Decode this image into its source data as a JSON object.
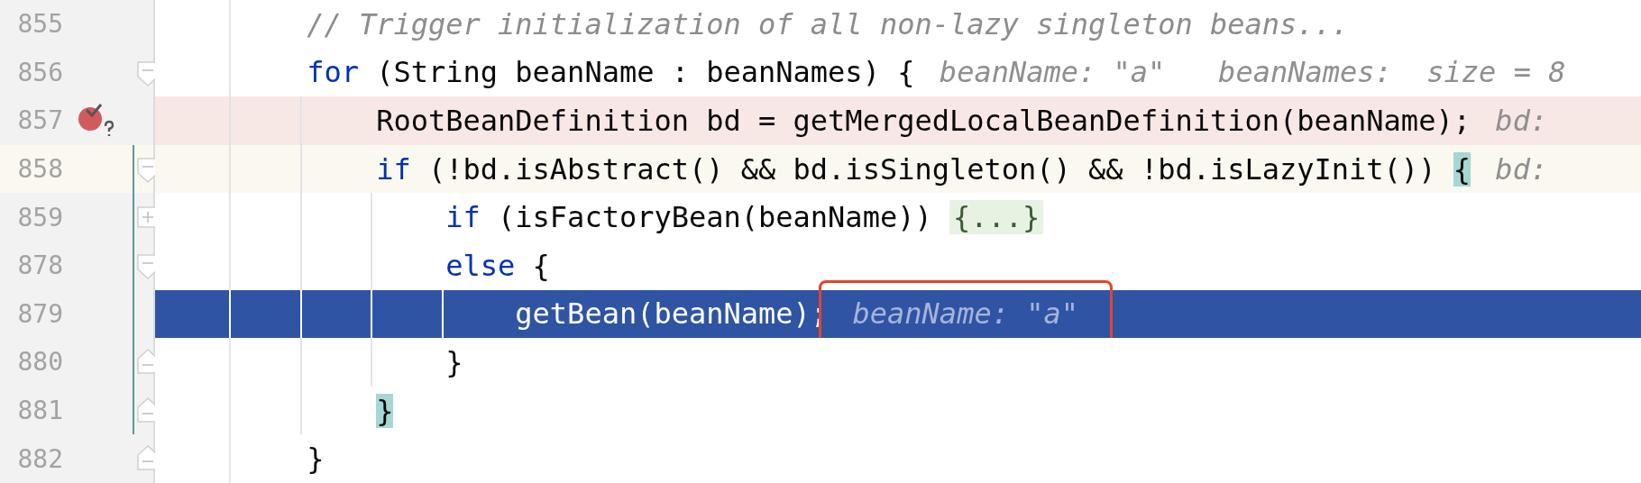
{
  "editor": {
    "lines": [
      {
        "number": "855",
        "kind": "normal",
        "tokens": [
          {
            "kind": "comment",
            "text": "        // Trigger initialization of all non-lazy singleton beans..."
          }
        ]
      },
      {
        "number": "856",
        "kind": "normal",
        "fold": {
          "kind": "start"
        },
        "tokens": [
          {
            "kind": "keyword",
            "text": "        for"
          },
          {
            "kind": "plain",
            "text": " (String beanName : beanNames) {"
          }
        ],
        "hints": [
          {
            "text": "beanName: \"a\""
          },
          {
            "text": "beanNames:  size = 8"
          }
        ]
      },
      {
        "number": "857",
        "kind": "breakpoint",
        "breakpoint": true,
        "tokens": [
          {
            "kind": "plain",
            "text": "            RootBeanDefinition bd = getMergedLocalBeanDefinition(beanName);"
          }
        ],
        "hints": [
          {
            "text": "bd:"
          }
        ]
      },
      {
        "number": "858",
        "kind": "caret",
        "fold": {
          "kind": "start"
        },
        "changed": true,
        "tokens": [
          {
            "kind": "keyword",
            "text": "            if"
          },
          {
            "kind": "plain",
            "text": " (!bd.isAbstract() && bd.isSingleton() && !bd.isLazyInit()) "
          },
          {
            "kind": "brace",
            "text": "{"
          }
        ],
        "hints": [
          {
            "text": "bd:"
          }
        ]
      },
      {
        "number": "859",
        "kind": "normal",
        "fold": {
          "kind": "collapsed"
        },
        "changed": true,
        "tokens": [
          {
            "kind": "keyword",
            "text": "                if"
          },
          {
            "kind": "plain",
            "text": " (isFactoryBean(beanName)) "
          },
          {
            "kind": "folded",
            "text": "{...}"
          }
        ]
      },
      {
        "number": "878",
        "kind": "normal",
        "fold": {
          "kind": "start"
        },
        "changed": true,
        "tokens": [
          {
            "kind": "keyword",
            "text": "                else"
          },
          {
            "kind": "plain",
            "text": " {"
          }
        ]
      },
      {
        "number": "879",
        "kind": "execution",
        "changed": true,
        "tokens": [
          {
            "kind": "plain",
            "text": "                    getBean(beanName);"
          }
        ],
        "hints": [
          {
            "text": "beanName: \"a\"",
            "highlighted": true
          }
        ]
      },
      {
        "number": "880",
        "kind": "normal",
        "fold": {
          "kind": "end"
        },
        "changed": true,
        "tokens": [
          {
            "kind": "plain",
            "text": "                }"
          }
        ]
      },
      {
        "number": "881",
        "kind": "normal",
        "fold": {
          "kind": "end"
        },
        "changed": true,
        "tokens": [
          {
            "kind": "brace",
            "text": "            }"
          }
        ]
      },
      {
        "number": "882",
        "kind": "normal",
        "fold": {
          "kind": "end"
        },
        "tokens": [
          {
            "kind": "plain",
            "text": "        }"
          }
        ]
      }
    ]
  }
}
